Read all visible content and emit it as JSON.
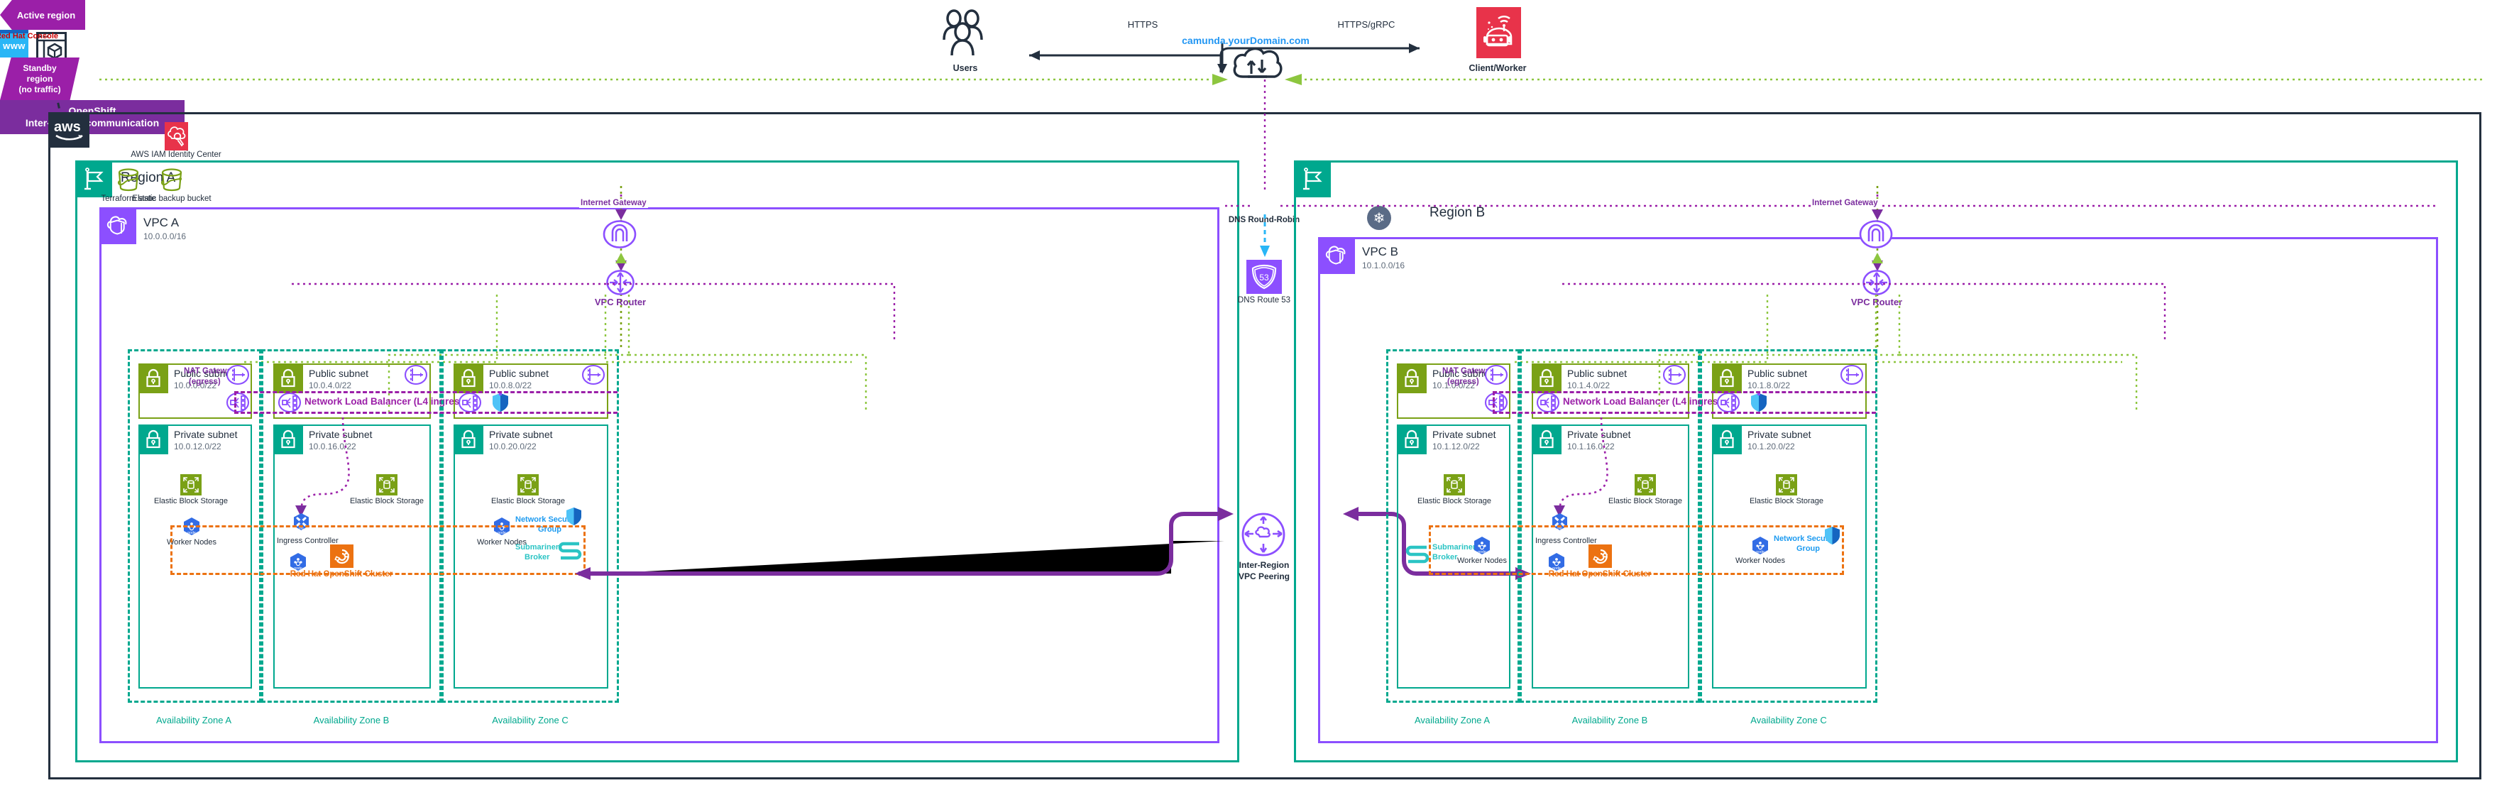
{
  "external": {
    "redhat_console": "Red Hat Console",
    "users": "Users",
    "client_worker": "Client/Worker",
    "https": "HTTPS",
    "https_grpc": "HTTPS/gRPC",
    "domain": "camunda.yourDomain.com"
  },
  "aws": {
    "iam_identity_center": "AWS IAM Identity Center"
  },
  "center": {
    "active_region": "Active region",
    "standby_region": "Standby\nregion\n(no traffic)",
    "standby_region_lines": [
      "Standby",
      "region",
      "(no traffic)"
    ],
    "www": "www",
    "dns_round_robin": "DNS Round-Robin",
    "dns_route53": "DNS Route 53",
    "route53_number": "53",
    "peering_lines": [
      "Inter-Region",
      "VPC Peering"
    ],
    "openshift_ribbon_lines": [
      "OpenShift",
      "Inter-cluster communication"
    ]
  },
  "colors": {
    "aws_dark": "#232f3e",
    "region_teal": "#00a88e",
    "vpc_purple": "#8c4fff",
    "public_green": "#7aa116",
    "nlb_magenta": "#9b1fa8",
    "openshift_orange": "#ec7211",
    "submariner_cyan": "#2bc4c4",
    "nsg_blue": "#1e9bf0",
    "redhat_red": "#cc0000",
    "domain_blue": "#2196f3",
    "ribbon_purple": "#7b2d9e"
  },
  "regions": [
    {
      "name": "Region A",
      "buckets": [
        {
          "label": "Terraform state"
        },
        {
          "label": "Elastic backup bucket"
        }
      ],
      "vpc": {
        "name": "VPC A",
        "cidr": "10.0.0.0/16"
      },
      "internet_gateway": "Internet Gateway",
      "vpc_router": "VPC Router",
      "nlb_label": "Network Load Balancer (L4 ingress)",
      "azs": [
        {
          "label": "Availability Zone A",
          "public": {
            "title": "Public subnet",
            "cidr": "10.0.0.0/22"
          },
          "private": {
            "title": "Private subnet",
            "cidr": "10.0.12.0/22"
          },
          "nat_gateway_lines": [
            "NAT Gateway",
            "(egress)"
          ],
          "ebs": "Elastic Block Storage",
          "worker_nodes": "Worker Nodes",
          "node_badge": "node"
        },
        {
          "label": "Availability Zone B",
          "public": {
            "title": "Public subnet",
            "cidr": "10.0.4.0/22"
          },
          "private": {
            "title": "Private subnet",
            "cidr": "10.0.16.0/22"
          },
          "ingress_controller": "Ingress Controller",
          "ebs": "Elastic Block Storage",
          "openshift_cluster": "Red Hat OpenShift Cluster",
          "node_badge": "node",
          "ing_badge": "ing"
        },
        {
          "label": "Availability Zone C",
          "public": {
            "title": "Public subnet",
            "cidr": "10.0.8.0/22"
          },
          "private": {
            "title": "Private subnet",
            "cidr": "10.0.20.0/22"
          },
          "ebs": "Elastic Block Storage",
          "worker_nodes": "Worker Nodes",
          "nsg_lines": [
            "Network Security",
            "Group"
          ],
          "submariner_lines": [
            "Submariner",
            "Broker"
          ],
          "node_badge": "node"
        }
      ]
    },
    {
      "name": "Region B",
      "vpc": {
        "name": "VPC B",
        "cidr": "10.1.0.0/16"
      },
      "internet_gateway": "Internet Gateway",
      "vpc_router": "VPC Router",
      "nlb_label": "Network Load Balancer (L4 ingress)",
      "azs": [
        {
          "label": "Availability Zone A",
          "public": {
            "title": "Public subnet",
            "cidr": "10.1.0.0/22"
          },
          "private": {
            "title": "Private subnet",
            "cidr": "10.1.12.0/22"
          },
          "nat_gateway_lines": [
            "NAT Gateway",
            "(egress)"
          ],
          "ebs": "Elastic Block Storage",
          "worker_nodes": "Worker Nodes",
          "submariner_lines": [
            "Submariner",
            "Broker"
          ],
          "node_badge": "node"
        },
        {
          "label": "Availability Zone B",
          "public": {
            "title": "Public subnet",
            "cidr": "10.1.4.0/22"
          },
          "private": {
            "title": "Private subnet",
            "cidr": "10.1.16.0/22"
          },
          "ingress_controller": "Ingress Controller",
          "ebs": "Elastic Block Storage",
          "openshift_cluster": "Red Hat OpenShift Cluster",
          "node_badge": "node",
          "ing_badge": "ing"
        },
        {
          "label": "Availability Zone C",
          "public": {
            "title": "Public subnet",
            "cidr": "10.1.8.0/22"
          },
          "private": {
            "title": "Private subnet",
            "cidr": "10.1.20.0/22"
          },
          "ebs": "Elastic Block Storage",
          "worker_nodes": "Worker Nodes",
          "nsg_lines": [
            "Network Security",
            "Group"
          ],
          "node_badge": "node"
        }
      ]
    }
  ]
}
